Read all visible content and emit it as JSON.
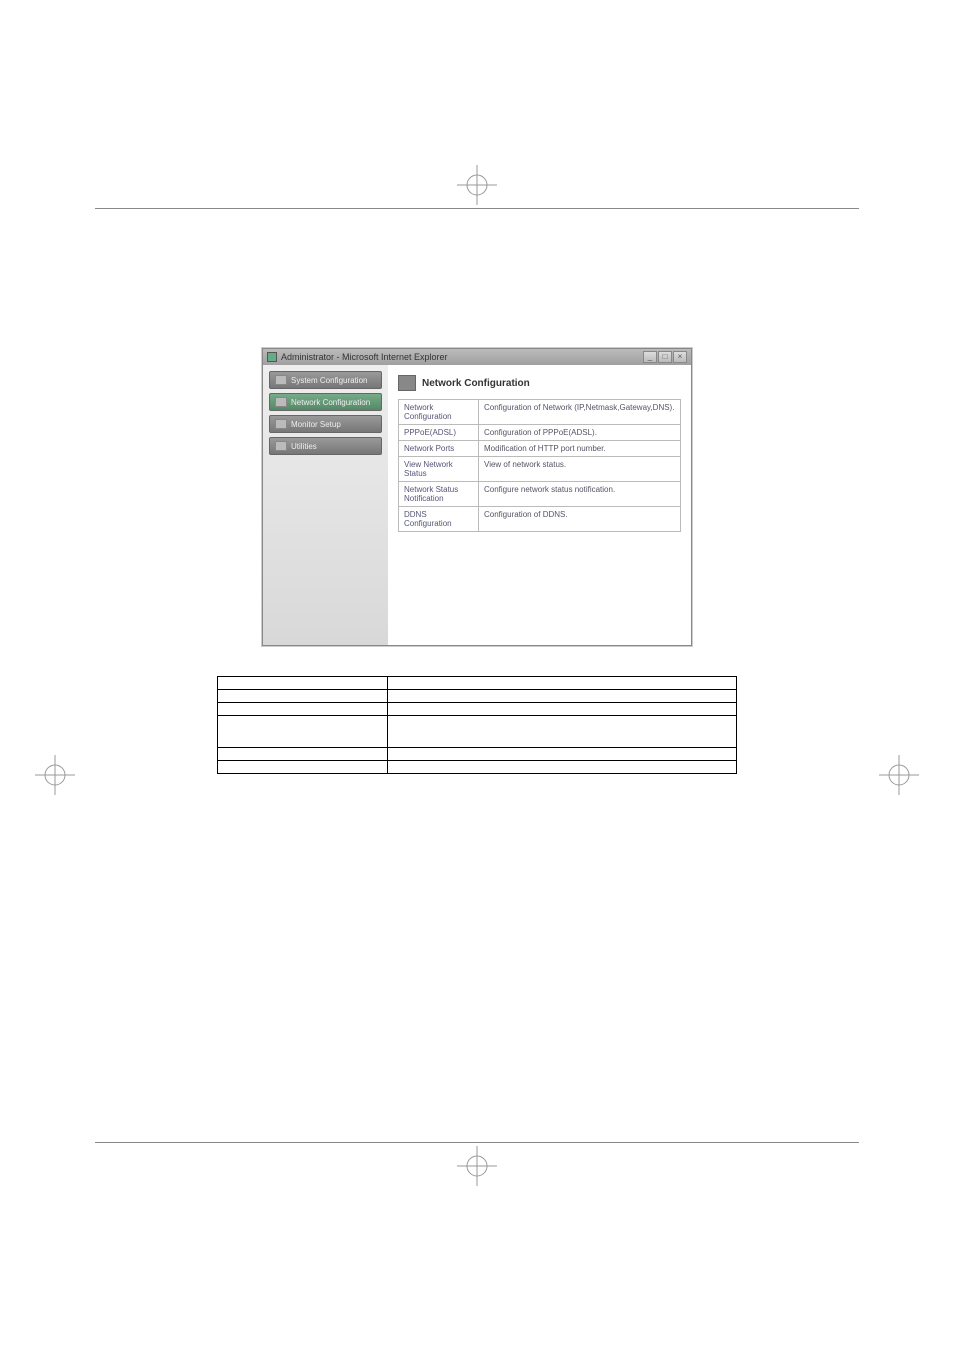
{
  "titlebar": {
    "text": "Administrator - Microsoft Internet Explorer",
    "minimize": "_",
    "maximize": "□",
    "close": "×"
  },
  "sidebar": {
    "items": [
      {
        "label": "System Configuration"
      },
      {
        "label": "Network Configuration"
      },
      {
        "label": "Monitor Setup"
      },
      {
        "label": "Utilities"
      }
    ]
  },
  "main": {
    "title": "Network Configuration",
    "rows": [
      {
        "name": "Network Configuration",
        "desc": "Configuration of Network (IP,Netmask,Gateway,DNS)."
      },
      {
        "name": "PPPoE(ADSL)",
        "desc": "Configuration of PPPoE(ADSL)."
      },
      {
        "name": "Network Ports",
        "desc": "Modification of HTTP port number."
      },
      {
        "name": "View Network Status",
        "desc": "View of network status."
      },
      {
        "name": "Network Status Notification",
        "desc": "Configure network status notification."
      },
      {
        "name": "DDNS Configuration",
        "desc": "Configuration of DDNS."
      }
    ]
  },
  "definitions": {
    "rows": [
      {
        "term": "",
        "desc": ""
      },
      {
        "term": "",
        "desc": ""
      },
      {
        "term": "",
        "desc": ""
      },
      {
        "term": "",
        "desc": ""
      },
      {
        "term": "",
        "desc": ""
      },
      {
        "term": "",
        "desc": ""
      }
    ]
  }
}
